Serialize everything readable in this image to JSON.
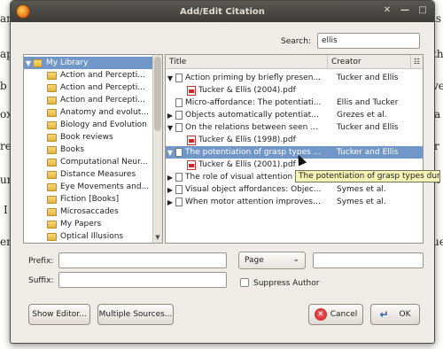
{
  "window": {
    "title": "Add/Edit Citation"
  },
  "search": {
    "label": "Search:",
    "value": "ellis"
  },
  "library": {
    "items": [
      {
        "label": "My Library",
        "selected": true
      },
      {
        "label": "Action and Percepti..."
      },
      {
        "label": "Action and Percepti..."
      },
      {
        "label": "Action and Percepti..."
      },
      {
        "label": "Anatomy and evolut..."
      },
      {
        "label": "Biology and Evolution"
      },
      {
        "label": "Book reviews"
      },
      {
        "label": "Books"
      },
      {
        "label": "Computational Neur..."
      },
      {
        "label": "Distance Measures"
      },
      {
        "label": "Eye Movements and..."
      },
      {
        "label": "Fiction [Books]"
      },
      {
        "label": "Microsaccades"
      },
      {
        "label": "My Papers"
      },
      {
        "label": "Optical Illusions"
      }
    ]
  },
  "items": {
    "columns": {
      "title": "Title",
      "creator": "Creator"
    },
    "rows": [
      {
        "title": "Action priming by briefly presen...",
        "creator": "Tucker and Ellis",
        "kind": "item",
        "expanded": true
      },
      {
        "title": "Tucker & Ellis (2004).pdf",
        "creator": "",
        "kind": "pdf"
      },
      {
        "title": "Micro-affordance: The potentiati...",
        "creator": "Ellis and Tucker",
        "kind": "item"
      },
      {
        "title": "Objects automatically potentiate...",
        "creator": "Grezes et al.",
        "kind": "item",
        "collapsed": true
      },
      {
        "title": "On the relations between seen o...",
        "creator": "Tucker and Ellis",
        "kind": "item",
        "expanded": true
      },
      {
        "title": "Tucker & Ellis (1998).pdf",
        "creator": "",
        "kind": "pdf"
      },
      {
        "title": "The potentiation of grasp types ...",
        "creator": "Tucker and Ellis",
        "kind": "item",
        "expanded": true,
        "selected": true
      },
      {
        "title": "Tucker & Ellis (2001).pdf",
        "creator": "",
        "kind": "pdf"
      },
      {
        "title": "The role of visual attention",
        "creator": "",
        "kind": "item",
        "collapsed": true
      },
      {
        "title": "Visual object affordances: Objec...",
        "creator": "Symes et al.",
        "kind": "item",
        "collapsed": true
      },
      {
        "title": "When motor attention improves ...",
        "creator": "Symes et al.",
        "kind": "item",
        "collapsed": true
      }
    ]
  },
  "tooltip": {
    "text": "The potentiation of grasp types during"
  },
  "form": {
    "prefix_label": "Prefix:",
    "suffix_label": "Suffix:",
    "locator_value": "Page",
    "suppress_author_label": "Suppress Author"
  },
  "buttons": {
    "show_editor": "Show Editor...",
    "multiple_sources": "Multiple Sources...",
    "cancel": "Cancel",
    "ok": "OK"
  },
  "background": {
    "fragments": [
      "an",
      "ap",
      "b Z",
      "ox",
      "re",
      "ur",
      "I",
      "er",
      "is",
      "th",
      "ve",
      "a",
      "r",
      "it",
      "ue"
    ]
  }
}
